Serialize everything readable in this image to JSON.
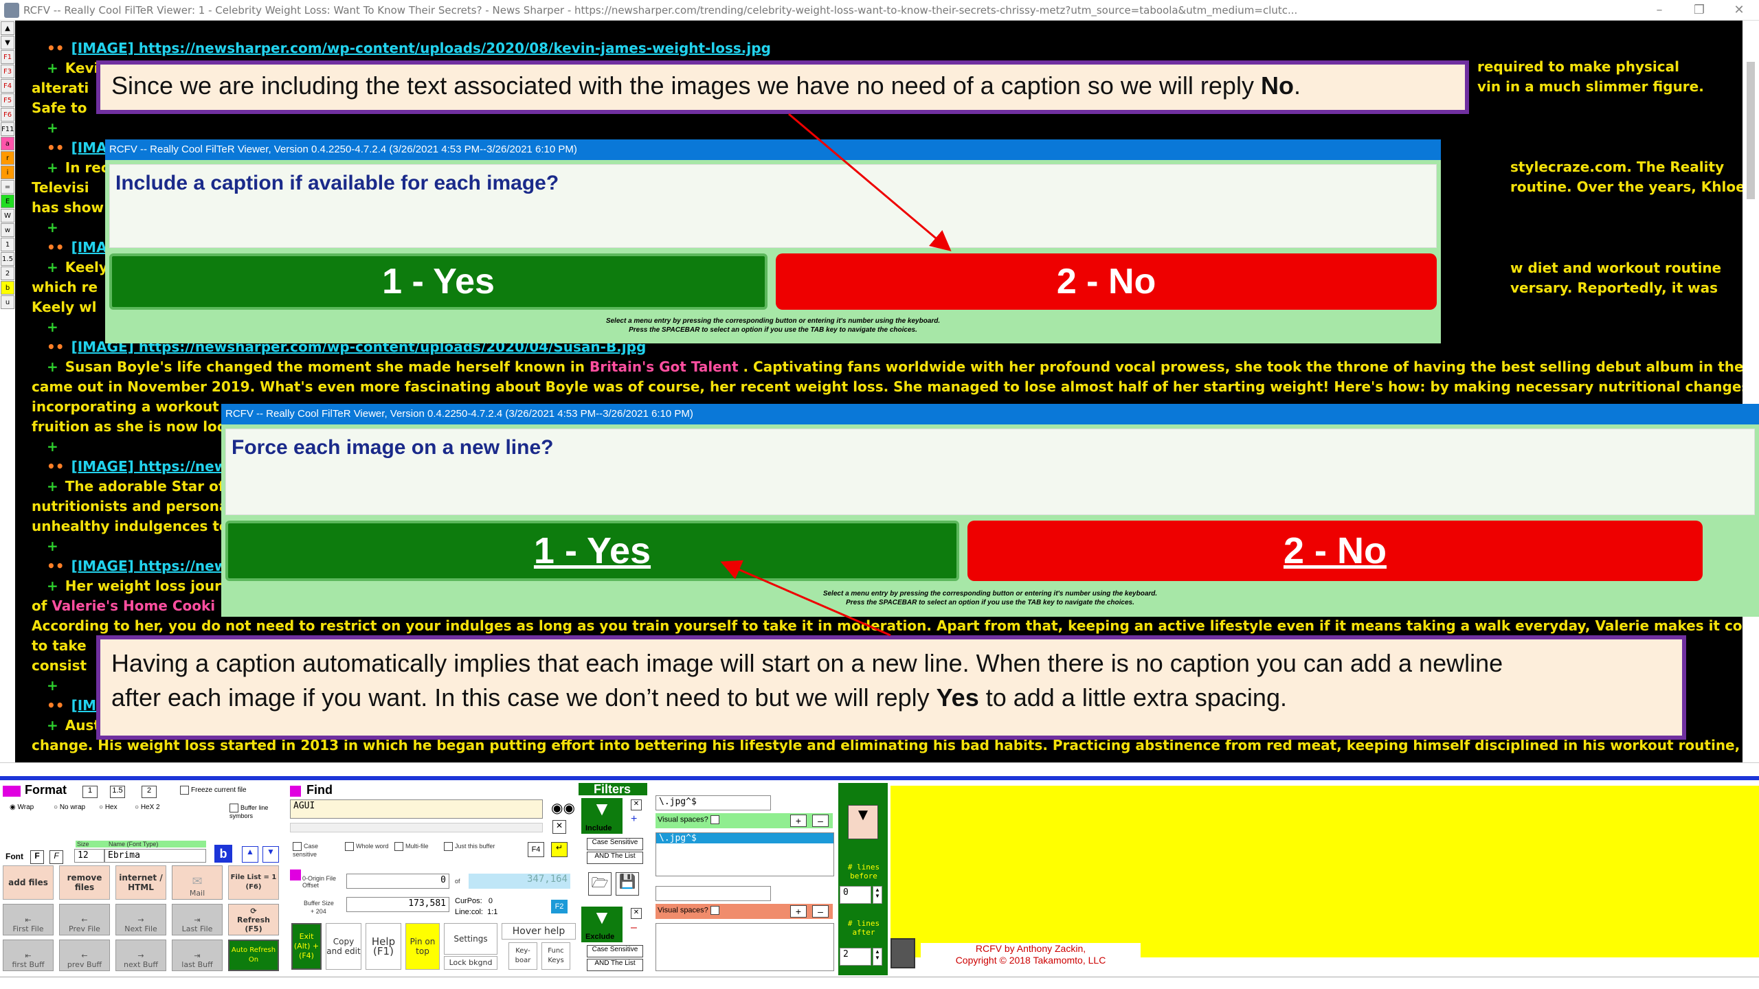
{
  "window": {
    "title": "RCFV -- Really Cool FilTeR Viewer: 1 - Celebrity Weight Loss: Want To Know Their Secrets? - News Sharper - https://newsharper.com/trending/celebrity-weight-loss-want-to-know-their-secrets-chrissy-metz?utm_source=taboola&utm_medium=clutc..."
  },
  "left_strip": [
    "F1",
    "F3",
    "F4",
    "F5",
    "F6",
    "F11",
    "a",
    "r",
    "i",
    "=",
    "E",
    "W",
    "w",
    "1",
    "1.5",
    "2",
    "b",
    "u"
  ],
  "content": {
    "lines": [
      {
        "type": "image",
        "text": "[IMAGE] https://newsharper.com/wp-content/uploads/2020/08/kevin-james-weight-loss.jpg"
      },
      {
        "type": "text",
        "text": "Kevi"
      },
      {
        "type": "cont",
        "text": "alterati"
      },
      {
        "type": "cont",
        "text": "Safe to"
      },
      {
        "type": "plus",
        "text": ""
      },
      {
        "type": "image",
        "text": "[IMA"
      },
      {
        "type": "text",
        "text": "In rec"
      },
      {
        "type": "cont",
        "text": "Televisi"
      },
      {
        "type": "cont",
        "text": "has show"
      },
      {
        "type": "plus",
        "text": ""
      },
      {
        "type": "image",
        "text": "[IMA"
      },
      {
        "type": "text",
        "text": "Keely"
      },
      {
        "type": "cont",
        "text": "which re"
      },
      {
        "type": "cont",
        "text": "Keely wl"
      },
      {
        "type": "plus",
        "text": ""
      },
      {
        "type": "image",
        "text": "[IMAGE] https://newsharper.com/wp-content/uploads/2020/04/Susan-B.jpg"
      },
      {
        "type": "susan",
        "text": "Susan Boyle's life changed the moment she made herself known in ",
        "pink": "Britain's Got Talent",
        "rest": " . Captivating fans worldwide with her profound vocal prowess, she took the throne of having the best selling debut album in the UK when hers"
      },
      {
        "type": "cont",
        "text": "came out in November 2019. What's even more fascinating about Boyle was of course, her recent weight loss. She managed to lose almost half of her starting weight! Here's how: by making necessary nutritional changes to her diet and"
      },
      {
        "type": "cont",
        "text": "incorporating a workout"
      },
      {
        "type": "cont",
        "text": "fruition as she is now loo"
      },
      {
        "type": "plus",
        "text": ""
      },
      {
        "type": "image",
        "text": "[IMAGE] https://news"
      },
      {
        "type": "text",
        "text": "The adorable Star of"
      },
      {
        "type": "cont",
        "text": "nutritionists and persona"
      },
      {
        "type": "cont",
        "text": "unhealthy indulgences to"
      },
      {
        "type": "plus",
        "text": ""
      },
      {
        "type": "image",
        "text": "[IMAGE] https://news"
      },
      {
        "type": "text",
        "text": "Her weight loss journe"
      },
      {
        "type": "valerie",
        "text": "of ",
        "pink": "Valerie's Home Cooki"
      },
      {
        "type": "cont",
        "text": "According to her, you do not need to restrict on your indulges as long as you train yourself to take it in moderation. Apart from that, keeping an active lifestyle even if it means taking a walk everyday, Valerie makes it compulsory for herself"
      },
      {
        "type": "cont",
        "text": "to take"
      },
      {
        "type": "cont",
        "text": "consist"
      },
      {
        "type": "plus",
        "text": ""
      },
      {
        "type": "image",
        "text": "[IMI"
      },
      {
        "type": "text",
        "text": "Aust"
      },
      {
        "type": "cont",
        "text": "change. His weight loss started in 2013 in which he began putting effort into bettering his lifestyle and eliminating his bad habits. Practicing abstinence from red meat, keeping himself disciplined in his workout routine, and incorporating"
      }
    ],
    "right_fragments": [
      {
        "text": "required to make physical"
      },
      {
        "text": "vin in a much slimmer figure."
      },
      {
        "text": "stylecraze.com. The Reality"
      },
      {
        "text": "routine. Over the years, Khloe"
      },
      {
        "text": "w diet and workout routine"
      },
      {
        "text": "versary. Reportedly, it was"
      }
    ]
  },
  "annotations": {
    "top": {
      "before": "Since we are including the text associated with the images we have no need of a caption so we will reply ",
      "bold": "No",
      "after": "."
    },
    "bottom": {
      "line1": "Having a caption automatically implies that each image will start on a new line. When there is no caption you can add a newline",
      "line2_before": "after each image if you want.  In this case we don’t need to but we will reply ",
      "bold": "Yes",
      "line2_after": " to add a little extra spacing."
    }
  },
  "dialog1": {
    "title": "RCFV -- Really Cool FilTeR Viewer, Version 0.4.2250-4.7.2.4 (3/26/2021 4:53 PM--3/26/2021 6:10 PM)",
    "question": "Include a caption if available for each image?",
    "yes": "1 - Yes",
    "no": "2 - No",
    "hint1": "Select a menu entry by pressing the corresponding button or entering it's number using the keyboard.",
    "hint2": "Press the SPACEBAR to select an option if you use the TAB key to navigate the choices."
  },
  "dialog2": {
    "title": "RCFV -- Really Cool FilTeR Viewer, Version 0.4.2250-4.7.2.4 (3/26/2021 4:53 PM--3/26/2021 6:10 PM)",
    "question": "Force each image on a new line?",
    "yes": "1 - Yes",
    "no": "2 - No",
    "hint1": "Select a menu entry by pressing the corresponding button or entering it's number using the keyboard.",
    "hint2": "Press the SPACEBAR to select an option if you use the TAB key to navigate the choices."
  },
  "bottom": {
    "format": {
      "title": "Format",
      "b1": "1",
      "b15": "1.5",
      "b2": "2",
      "freeze": "Freeze current file",
      "wrap": "Wrap",
      "nowrap": "No wrap",
      "hex": "Hex",
      "hex2": "HeX 2",
      "buffer_line": "Buffer line symbors",
      "size_label": "Size",
      "name_label": "Name (Font Type)",
      "size": "12",
      "font_name": "Ebrima",
      "font": "Font",
      "f1": "F",
      "f2": "F",
      "bold": "b"
    },
    "file_buttons": {
      "add": "add files",
      "remove": "remove files",
      "internet": "internet / HTML",
      "mail": "Mail",
      "filelist": "File List = 1 (F6)",
      "first_file": "First File",
      "prev_file": "Prev File",
      "next_file": "Next File",
      "last_file": "Last File",
      "refresh": "Refresh (F5)",
      "first_buff": "first Buff",
      "prev_buff": "prev Buff",
      "next_buff": "next Buff",
      "last_buff": "last Buff",
      "auto_refresh": "Auto Refresh On"
    },
    "find": {
      "title": "Find",
      "value": "AGUI",
      "case": "Case sensitive",
      "whole": "Whole word",
      "multi": "Multi-file",
      "just": "Just this buffer",
      "f4": "F4",
      "origin_label": "0-Origin File Offset",
      "origin_val": "0",
      "of": "of",
      "of_val": "347,164",
      "buffer_label": "Buffer Size",
      "buffer_sub": "+ 204",
      "buffer_val": "173,581",
      "curpos_label": "CurPos:",
      "curpos_val": "0",
      "linecol_label": "Line:col:",
      "linecol_val": "1:1",
      "f2": "F2"
    },
    "actions": {
      "exit": "Exit (Alt) + (F4)",
      "copy": "Copy and edit",
      "help": "Help (F1)",
      "pin": "Pin on top",
      "settings": "Settings",
      "lock": "Lock bkgnd",
      "hover": "Hover help",
      "keyboard": "Key-boar",
      "func": "Func Keys"
    },
    "filters": {
      "title": "Filters",
      "include": "Include",
      "exclude": "Exclude",
      "case_sensitive": "Case Sensitive",
      "and_list": "AND The List",
      "pattern": "\\.jpg^$",
      "list_item": "\\.jpg^$",
      "visual_spaces": "Visual spaces?",
      "lines_before": "# lines before",
      "lines_before_val": "0",
      "lines_after": "# lines after",
      "lines_after_val": "2"
    },
    "credit_line1": "RCFV by Anthony Zackin,",
    "credit_line2": "Copyright © 2018 Takamomto, LLC"
  }
}
